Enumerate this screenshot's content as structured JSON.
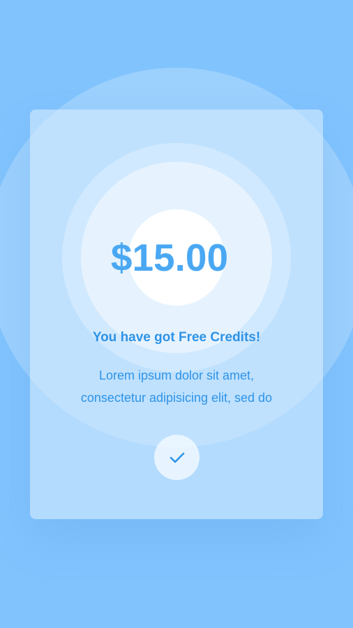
{
  "colors": {
    "background": "#81c3fd",
    "accent": "#4aa8f3",
    "text": "#2f93e6"
  },
  "reward": {
    "amount": "$15.00",
    "headline": "You have got Free Credits!",
    "description_line1": "Lorem ipsum dolor sit amet,",
    "description_line2": "consectetur adipisicing elit, sed do"
  },
  "confirm_button": {
    "icon": "checkmark-icon"
  }
}
